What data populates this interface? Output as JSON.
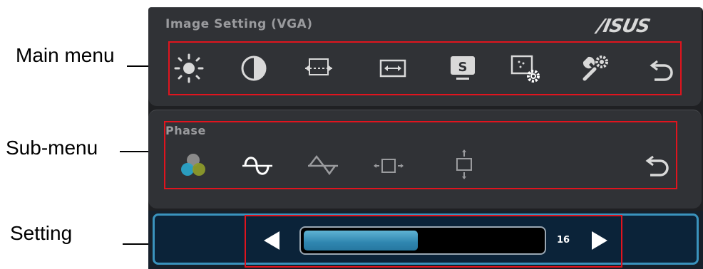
{
  "callouts": {
    "main_menu": "Main menu",
    "sub_menu": "Sub-menu",
    "setting": "Setting"
  },
  "main_menu": {
    "title": "Image Setting (VGA)",
    "brand": "/ISUS",
    "items": [
      {
        "icon": "brightness-icon"
      },
      {
        "icon": "contrast-icon"
      },
      {
        "icon": "image-position-icon"
      },
      {
        "icon": "aspect-ratio-icon"
      },
      {
        "icon": "splendid-icon",
        "glyph": "S"
      },
      {
        "icon": "image-setup-gear-icon"
      },
      {
        "icon": "system-setup-tools-icon"
      },
      {
        "icon": "return-icon"
      }
    ]
  },
  "sub_menu": {
    "title": "Phase",
    "items": [
      {
        "icon": "color-icon"
      },
      {
        "icon": "phase-icon"
      },
      {
        "icon": "clock-icon"
      },
      {
        "icon": "h-position-icon"
      },
      {
        "icon": "v-position-icon"
      },
      {
        "icon": "return-icon"
      }
    ]
  },
  "setting": {
    "value": "16",
    "level_percent": 48,
    "colors": {
      "fill": "#2f86b0",
      "border": "#3a93be"
    }
  },
  "colors": {
    "highlight_box": "#e0141e",
    "panel": "#303236"
  }
}
